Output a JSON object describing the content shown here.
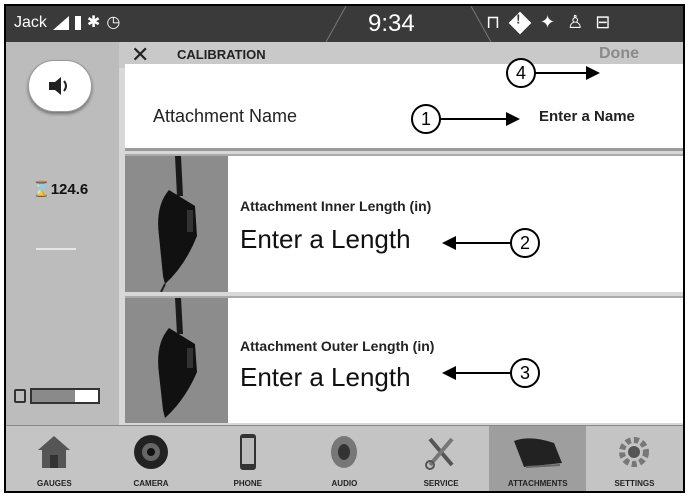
{
  "status_bar": {
    "user": "Jack",
    "time": "9:34"
  },
  "header": {
    "title": "CALIBRATION",
    "done_label": "Done"
  },
  "sidebar": {
    "hours": "124.6",
    "fuel_level": 0.65
  },
  "fields": {
    "name": {
      "label": "Attachment Name",
      "value": "Enter a Name"
    },
    "inner": {
      "label": "Attachment Inner Length (in)",
      "value": "Enter a Length"
    },
    "outer": {
      "label": "Attachment Outer Length (in)",
      "value": "Enter a Length"
    }
  },
  "callouts": [
    "1",
    "2",
    "3",
    "4"
  ],
  "bottom_nav": [
    {
      "label": "GAUGES",
      "icon": "house-icon"
    },
    {
      "label": "CAMERA",
      "icon": "camera-icon"
    },
    {
      "label": "PHONE",
      "icon": "phone-icon"
    },
    {
      "label": "AUDIO",
      "icon": "speaker-icon"
    },
    {
      "label": "SERVICE",
      "icon": "wrench-icon"
    },
    {
      "label": "ATTACHMENTS",
      "icon": "bucket-icon",
      "active": true
    },
    {
      "label": "SETTINGS",
      "icon": "gear-icon"
    }
  ]
}
